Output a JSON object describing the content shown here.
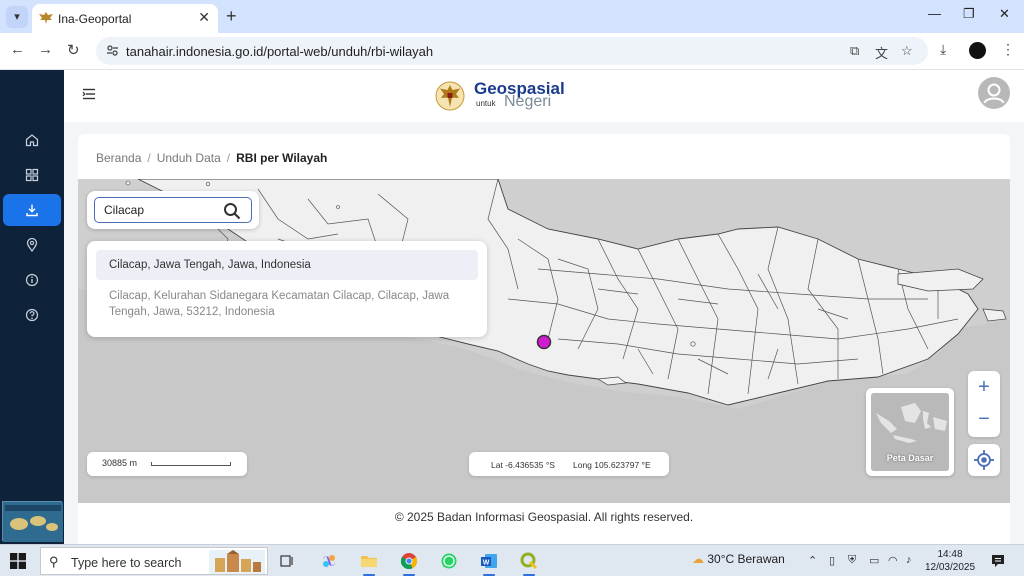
{
  "browser": {
    "tab_title": "Ina-Geoportal",
    "url": "tanahair.indonesia.go.id/portal-web/unduh/rbi-wilayah"
  },
  "header": {
    "logo_word1": "Geospasial",
    "logo_word2": "untuk",
    "logo_word3": "Negeri"
  },
  "breadcrumb": {
    "home": "Beranda",
    "section": "Unduh Data",
    "current": "RBI per Wilayah"
  },
  "search": {
    "value": "Cilacap",
    "results": [
      "Cilacap, Jawa Tengah, Jawa, Indonesia",
      "Cilacap, Kelurahan Sidanegara Kecamatan Cilacap, Cilacap, Jawa Tengah, Jawa, 53212, Indonesia"
    ]
  },
  "map": {
    "scale_text": "30885 m",
    "lat_text": "Lat -6.436535 °S",
    "lon_text": "Long 105.623797 °E",
    "zoom_in": "+",
    "zoom_out": "−",
    "basemap_label": "Peta Dasar",
    "marker_color": "#d11ad1"
  },
  "footer": {
    "copyright": "© 2025 Badan Informasi Geospasial. All rights reserved."
  },
  "taskbar": {
    "search_placeholder": "Type here to search",
    "weather": "30°C  Berawan",
    "time": "14:48",
    "date": "12/03/2025"
  },
  "colors": {
    "sidebar_bg": "#0e2339",
    "active_nav": "#1a73e8",
    "brand_blue": "#1b3c8c"
  }
}
